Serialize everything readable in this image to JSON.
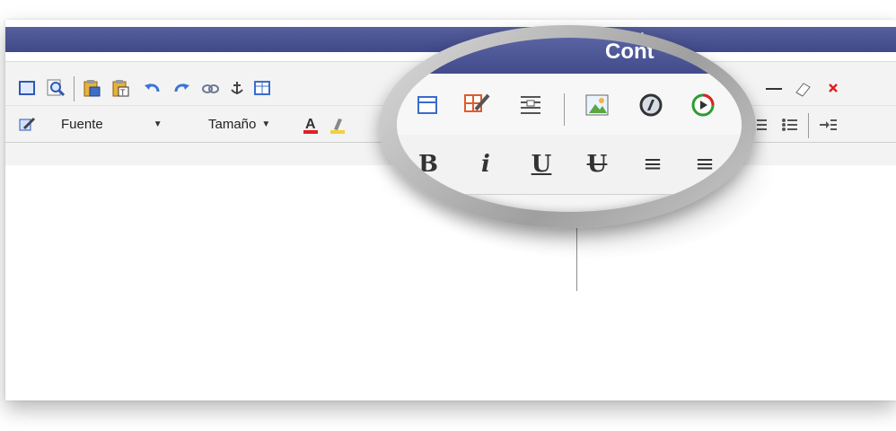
{
  "header": {
    "title": "Cont"
  },
  "toolbar": {
    "row1": [
      {
        "icon": "maximize-icon"
      },
      {
        "icon": "preview-icon"
      },
      {
        "icon": "paste-word-icon"
      },
      {
        "icon": "paste-text-icon"
      },
      {
        "icon": "undo-icon"
      },
      {
        "icon": "redo-icon"
      },
      {
        "icon": "link-icon"
      },
      {
        "icon": "anchor-icon"
      },
      {
        "icon": "table-icon"
      },
      {
        "icon": "table-edit-icon"
      },
      {
        "icon": "page-break-icon"
      },
      {
        "icon": "image-icon"
      },
      {
        "icon": "flash-icon"
      },
      {
        "icon": "media-icon"
      },
      {
        "icon": "horizontal-rule-icon"
      },
      {
        "icon": "eraser-icon"
      },
      {
        "icon": "close-icon"
      }
    ],
    "row2": {
      "font_label": "Fuente",
      "size_label": "Tamaño",
      "format_buttons": [
        "B",
        "i",
        "U",
        "U",
        "≡",
        "≡"
      ]
    }
  },
  "colors": {
    "header": "#404989",
    "close_red": "#e02020",
    "undo_blue": "#3a74d8"
  }
}
